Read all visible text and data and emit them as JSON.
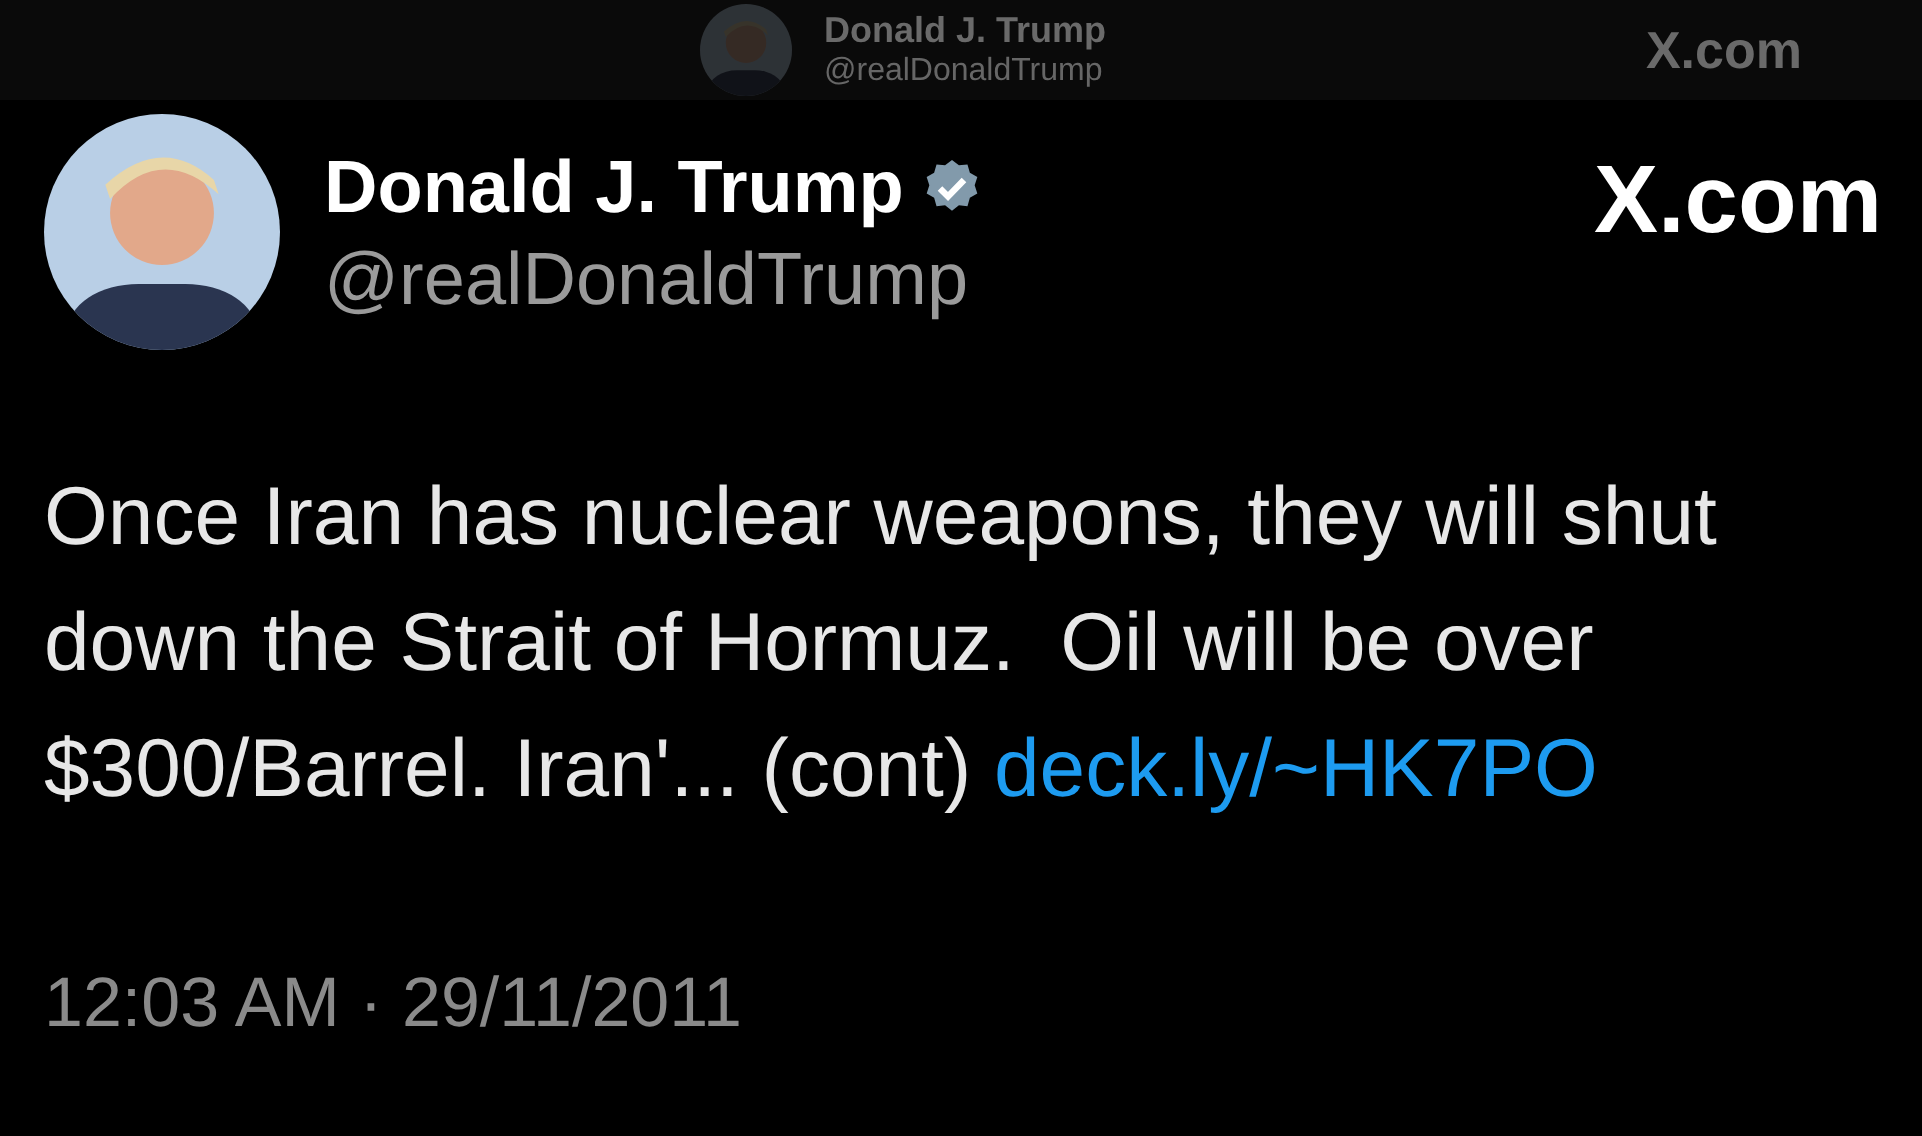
{
  "ghost_header": {
    "name": "Donald J. Trump",
    "handle": "@realDonaldTrump",
    "site": "X.com"
  },
  "tweet": {
    "name": "Donald J. Trump",
    "verified": true,
    "handle": "@realDonaldTrump",
    "site": "X.com",
    "text": "Once Iran has nuclear weapons, they will shut down the Strait of Hormuz.  Oil will be over $300/Barrel. Iran'... (cont)",
    "link": "deck.ly/~HK7PO",
    "timestamp": "12:03 AM · 29/11/2011"
  }
}
